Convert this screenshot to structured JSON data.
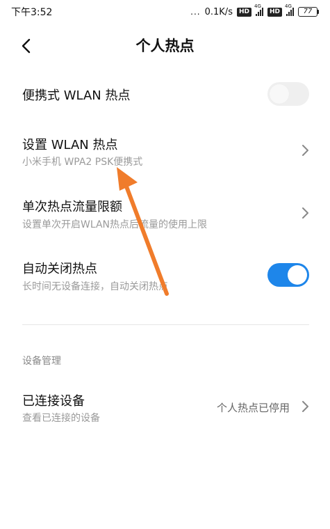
{
  "status_bar": {
    "time": "下午3:52",
    "dots": "...",
    "speed": "0.1K/s",
    "hd_label": "HD",
    "network_1": "4G",
    "network_2": "4G",
    "battery": "77"
  },
  "header": {
    "title": "个人热点"
  },
  "rows": {
    "portable": {
      "label": "便携式 WLAN 热点",
      "toggle_state": "off"
    },
    "setup": {
      "label": "设置 WLAN 热点",
      "sub": "小米手机 WPA2 PSK便携式"
    },
    "limit": {
      "label": "单次热点流量限额",
      "sub": "设置单次开启WLAN热点后流量的使用上限"
    },
    "autoclose": {
      "label": "自动关闭热点",
      "sub": "长时间无设备连接，自动关闭热点",
      "toggle_state": "on"
    }
  },
  "section": {
    "title": "设备管理"
  },
  "connected": {
    "label": "已连接设备",
    "sub": "查看已连接的设备",
    "value": "个人热点已停用"
  },
  "colors": {
    "accent": "#1e86ea",
    "annotation_arrow": "#f07c2b"
  },
  "icons": {
    "back": "back-arrow-icon",
    "chevron": "chevron-right-icon"
  }
}
